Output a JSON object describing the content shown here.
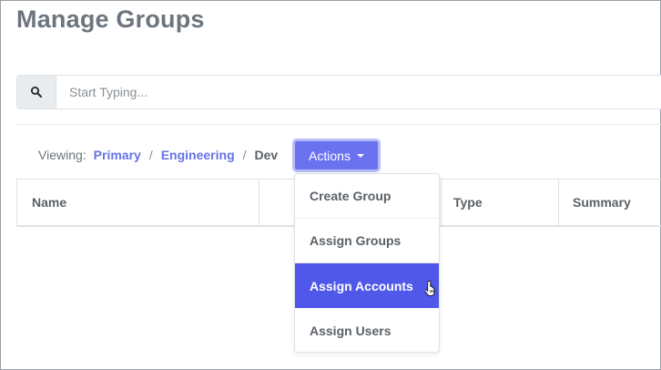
{
  "page": {
    "title": "Manage Groups"
  },
  "search": {
    "placeholder": "Start Typing...",
    "icon": "search-icon"
  },
  "breadcrumb": {
    "label": "Viewing:",
    "items": [
      "Primary",
      "Engineering",
      "Dev"
    ],
    "separator": "/"
  },
  "actions": {
    "label": "Actions"
  },
  "table": {
    "columns": [
      "Name",
      "Type",
      "Summary"
    ]
  },
  "dropdown": {
    "items": [
      "Create Group",
      "Assign Groups",
      "Assign Accounts",
      "Assign Users"
    ],
    "active_item": "Assign Accounts"
  },
  "colors": {
    "accent": "#6b72f0",
    "active_item": "#5058ea",
    "link": "#6673e6"
  }
}
